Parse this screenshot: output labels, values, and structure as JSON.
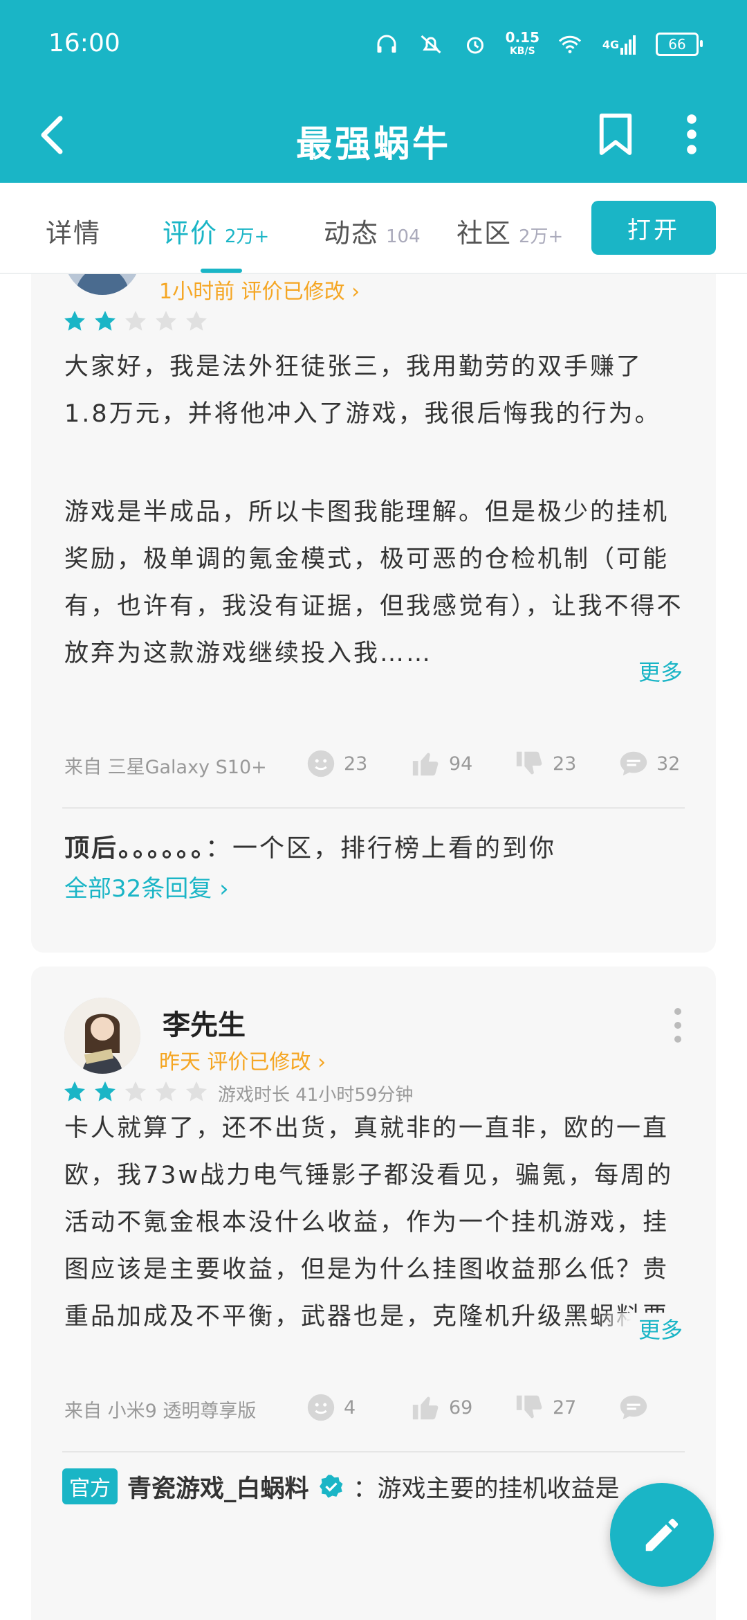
{
  "status_bar": {
    "time": "16:00",
    "speed_value": "0.15",
    "speed_unit": "KB/S",
    "network": "4G",
    "battery": "66"
  },
  "app_bar": {
    "title": "最强蜗牛"
  },
  "tabs": [
    {
      "label": "详情",
      "count": ""
    },
    {
      "label": "评价",
      "count": "2万+"
    },
    {
      "label": "动态",
      "count": "104"
    },
    {
      "label": "社区",
      "count": "2万+"
    }
  ],
  "open_button": "打开",
  "reviews": [
    {
      "meta": "1小时前 评价已修改 ›",
      "rating": 2,
      "paragraph1": "大家好，我是法外狂徒张三，我用勤劳的双手赚了1.8万元，并将他冲入了游戏，我很后悔我的行为。",
      "paragraph2": "游戏是半成品，所以卡图我能理解。但是极少的挂机奖励，极单调的氪金模式，极可恶的仓检机制（可能有，也许有，我没有证据，但我感觉有），让我不得不放弃为这款游戏继续投入我……",
      "more": "更多",
      "device": "来自 三星Galaxy S10+",
      "emoji_count": "23",
      "like_count": "94",
      "dislike_count": "23",
      "comment_count": "32",
      "reply_author": "顶后。。。。。。",
      "reply_text": "：一个区，排行榜上看的到你",
      "all_replies": "全部32条回复 ›"
    },
    {
      "username": "李先生",
      "meta": "昨天 评价已修改 ›",
      "rating": 2,
      "playtime": "游戏时长 41小时59分钟",
      "paragraph": "卡人就算了，还不出货，真就非的一直非，欧的一直欧，我73w战力电气锤影子都没看见，骗氪，每周的活动不氪金根本没什么收益，作为一个挂机游戏，挂图应该是主要收益，但是为什么挂图收益那么低？贵重品加成及不平衡，武器也是，克隆机升级黑蜗料要那么多还没什么用，是用来干嘛？博物馆也是，我都通关了还要精……",
      "more": "更多",
      "device": "来自 小米9 透明尊享版",
      "emoji_count": "4",
      "like_count": "69",
      "dislike_count": "27",
      "comment_count": "",
      "official_badge": "官方",
      "official_name": "青瓷游戏_白蜗料",
      "official_reply": "：游戏主要的挂机收益是"
    }
  ],
  "colors": {
    "accent": "#1ab5c6",
    "meta_orange": "#f5a623",
    "card_bg": "#f7f7f7"
  }
}
